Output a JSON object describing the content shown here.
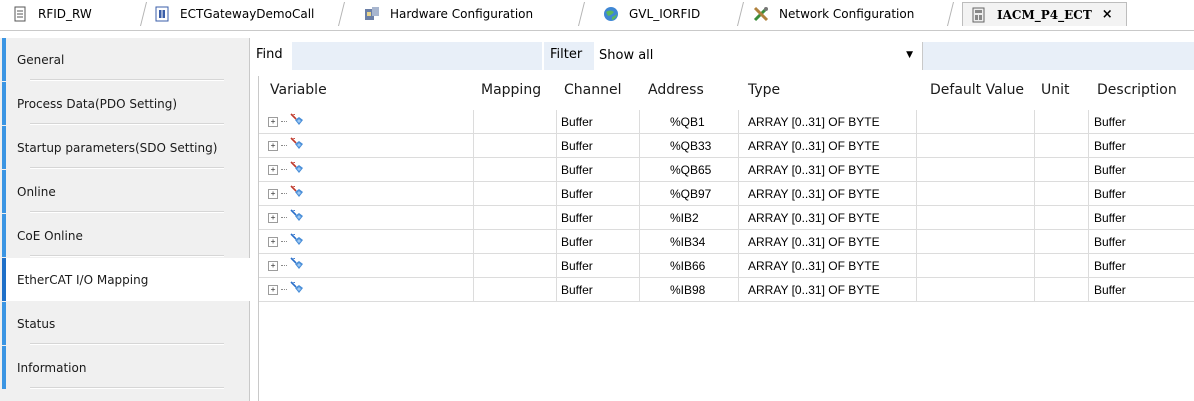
{
  "tabs": [
    {
      "label": "RFID_RW",
      "icon": "document-icon",
      "active": false
    },
    {
      "label": "ECTGatewayDemoCall",
      "icon": "function-block-icon",
      "active": false
    },
    {
      "label": "Hardware Configuration",
      "icon": "hardware-config-icon",
      "active": false
    },
    {
      "label": "GVL_IORFID",
      "icon": "globe-icon",
      "active": false
    },
    {
      "label": "Network Configuration",
      "icon": "network-tools-icon",
      "active": false
    },
    {
      "label": "IACM_P4_ECT",
      "icon": "device-icon",
      "active": true
    }
  ],
  "close_symbol": "×",
  "nav": [
    {
      "label": "General"
    },
    {
      "label": "Process Data(PDO Setting)"
    },
    {
      "label": "Startup parameters(SDO Setting)"
    },
    {
      "label": "Online"
    },
    {
      "label": "CoE Online"
    },
    {
      "label": "EtherCAT I/O Mapping",
      "active": true
    },
    {
      "label": "Status"
    },
    {
      "label": "Information"
    }
  ],
  "toolbar": {
    "find_label": "Find",
    "find_value": "",
    "filter_label": "Filter",
    "filter_value": "Show all"
  },
  "grid": {
    "headers": [
      "Variable",
      "Mapping",
      "Channel",
      "Address",
      "Type",
      "Default Value",
      "Unit",
      "Description"
    ],
    "rows": [
      {
        "direction": "output",
        "channel": "Buffer",
        "address": "%QB1",
        "type": "ARRAY [0..31] OF BYTE",
        "description": "Buffer"
      },
      {
        "direction": "output",
        "channel": "Buffer",
        "address": "%QB33",
        "type": "ARRAY [0..31] OF BYTE",
        "description": "Buffer"
      },
      {
        "direction": "output",
        "channel": "Buffer",
        "address": "%QB65",
        "type": "ARRAY [0..31] OF BYTE",
        "description": "Buffer"
      },
      {
        "direction": "output",
        "channel": "Buffer",
        "address": "%QB97",
        "type": "ARRAY [0..31] OF BYTE",
        "description": "Buffer"
      },
      {
        "direction": "input",
        "channel": "Buffer",
        "address": "%IB2",
        "type": "ARRAY [0..31] OF BYTE",
        "description": "Buffer"
      },
      {
        "direction": "input",
        "channel": "Buffer",
        "address": "%IB34",
        "type": "ARRAY [0..31] OF BYTE",
        "description": "Buffer"
      },
      {
        "direction": "input",
        "channel": "Buffer",
        "address": "%IB66",
        "type": "ARRAY [0..31] OF BYTE",
        "description": "Buffer"
      },
      {
        "direction": "input",
        "channel": "Buffer",
        "address": "%IB98",
        "type": "ARRAY [0..31] OF BYTE",
        "description": "Buffer"
      }
    ]
  },
  "colors": {
    "nav_accent": "#3b95e3",
    "toolbar_fill": "#e8eff8",
    "output_arrow": "#c0392b",
    "input_arrow": "#2a6fc9",
    "variable_icon": "#4a8fd8"
  }
}
